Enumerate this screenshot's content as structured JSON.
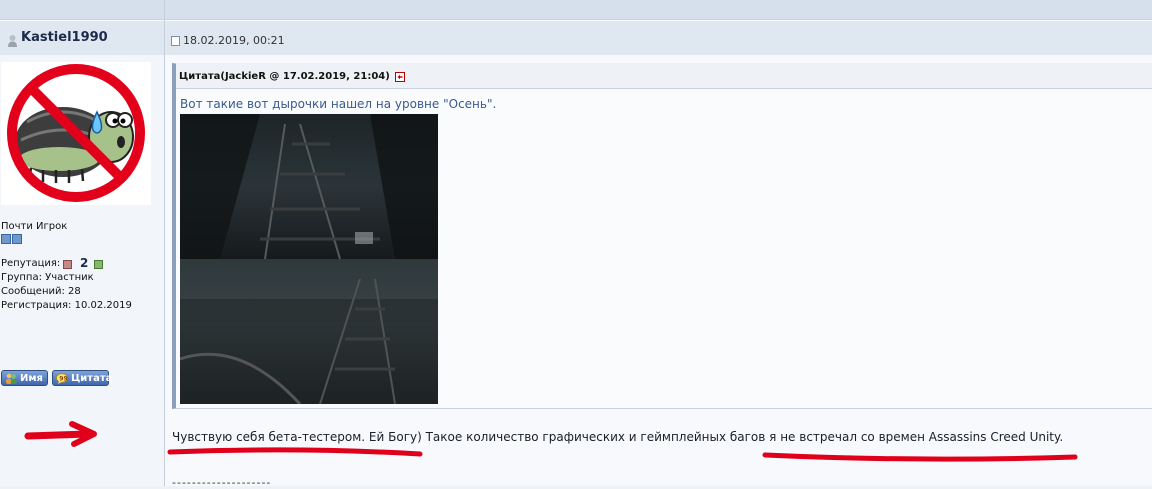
{
  "post": {
    "author": "Kastiel1990",
    "date": "18.02.2019, 00:21",
    "rank": "Почти Игрок",
    "reputation_label": "Репутация:",
    "reputation_value": "2",
    "group": "Группа: Участник",
    "messages": "Сообщений: 28",
    "registration": "Регистрация: 10.02.2019",
    "buttons": {
      "name": "Имя",
      "quote": "Цитата"
    },
    "quote": {
      "title": "Цитата(JackieR @ 17.02.2019, 21:04)",
      "text": "Вот такие вот дырочки нашел на уровне \"Осень\"."
    },
    "body_text": "Чувствую себя бета-тестером. Ей Богу) Такое количество графических и геймплейных багов я не встречал со времен Assassins Creed Unity.",
    "signature_divider": "--------------------"
  },
  "icons": {
    "user": "user-icon",
    "date": "document-icon",
    "rep_minus": "minus-icon",
    "rep_plus": "plus-icon",
    "quote_link": "arrow-back-icon",
    "name_button": "users-icon",
    "quote_button": "speech-bubble-icon"
  },
  "colors": {
    "annotation": "#e0001b",
    "quote_text": "#3b5a8e",
    "button": "#3f67ad"
  }
}
